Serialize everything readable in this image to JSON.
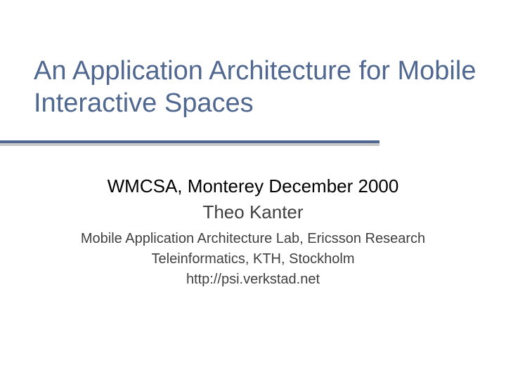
{
  "slide": {
    "title": "An Application Architecture for Mobile Interactive Spaces",
    "subtitle1": "WMCSA, Monterey December 2000",
    "subtitle2": "Theo Kanter",
    "detail1": "Mobile Application Architecture Lab, Ericsson Research",
    "detail2": "Teleinformatics, KTH, Stockholm",
    "detail3": "http://psi.verkstad.net"
  }
}
